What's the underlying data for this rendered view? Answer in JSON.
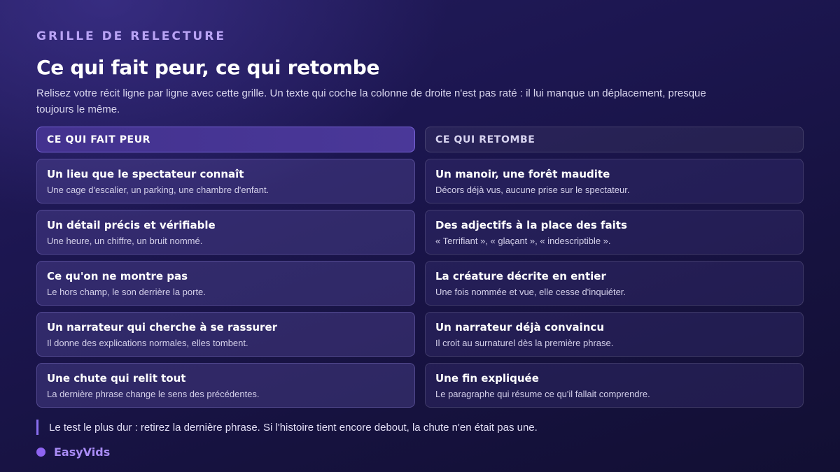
{
  "eyebrow": "GRILLE DE RELECTURE",
  "title": "Ce qui fait peur, ce qui retombe",
  "intro": "Relisez votre récit ligne par ligne avec cette grille. Un texte qui coche la colonne de droite n'est pas raté : il lui manque un déplacement, presque toujours le même.",
  "left": {
    "header": "CE QUI FAIT PEUR",
    "items": [
      {
        "title": "Un lieu que le spectateur connaît",
        "desc": "Une cage d'escalier, un parking, une chambre d'enfant."
      },
      {
        "title": "Un détail précis et vérifiable",
        "desc": "Une heure, un chiffre, un bruit nommé."
      },
      {
        "title": "Ce qu'on ne montre pas",
        "desc": "Le hors champ, le son derrière la porte."
      },
      {
        "title": "Un narrateur qui cherche à se rassurer",
        "desc": "Il donne des explications normales, elles tombent."
      },
      {
        "title": "Une chute qui relit tout",
        "desc": "La dernière phrase change le sens des précédentes."
      }
    ]
  },
  "right": {
    "header": "CE QUI RETOMBE",
    "items": [
      {
        "title": "Un manoir, une forêt maudite",
        "desc": "Décors déjà vus, aucune prise sur le spectateur."
      },
      {
        "title": "Des adjectifs à la place des faits",
        "desc": "« Terrifiant », « glaçant », « indescriptible »."
      },
      {
        "title": "La créature décrite en entier",
        "desc": "Une fois nommée et vue, elle cesse d'inquiéter."
      },
      {
        "title": "Un narrateur déjà convaincu",
        "desc": "Il croit au surnaturel dès la première phrase."
      },
      {
        "title": "Une fin expliquée",
        "desc": "Le paragraphe qui résume ce qu'il fallait comprendre."
      }
    ]
  },
  "tip": "Le test le plus dur : retirez la dernière phrase. Si l'histoire tient encore debout, la chute n'en était pas une.",
  "brand": {
    "name": "EasyVids",
    "dot_color": "#8f64f2"
  }
}
